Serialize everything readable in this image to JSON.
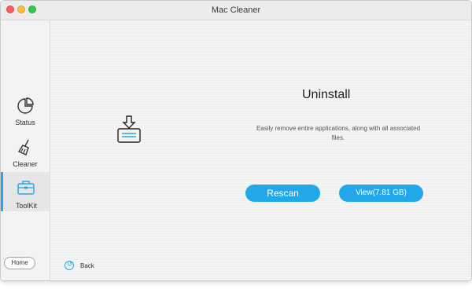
{
  "window": {
    "title": "Mac Cleaner"
  },
  "sidebar": {
    "items": [
      {
        "label": "Status",
        "icon": "pie-chart-icon"
      },
      {
        "label": "Cleaner",
        "icon": "broom-icon"
      },
      {
        "label": "ToolKit",
        "icon": "toolbox-icon",
        "active": true
      }
    ],
    "home_label": "Home"
  },
  "main": {
    "icon": "uninstall-icon",
    "title": "Uninstall",
    "description": "Easily remove entire applications, along with all associated files.",
    "rescan_label": "Rescan",
    "view_label": "View(7.81 GB)",
    "back_label": "Back"
  },
  "colors": {
    "accent": "#22a8e9",
    "sidebar_bg": "#f3f3f3",
    "main_bg": "#f4f4f4"
  }
}
